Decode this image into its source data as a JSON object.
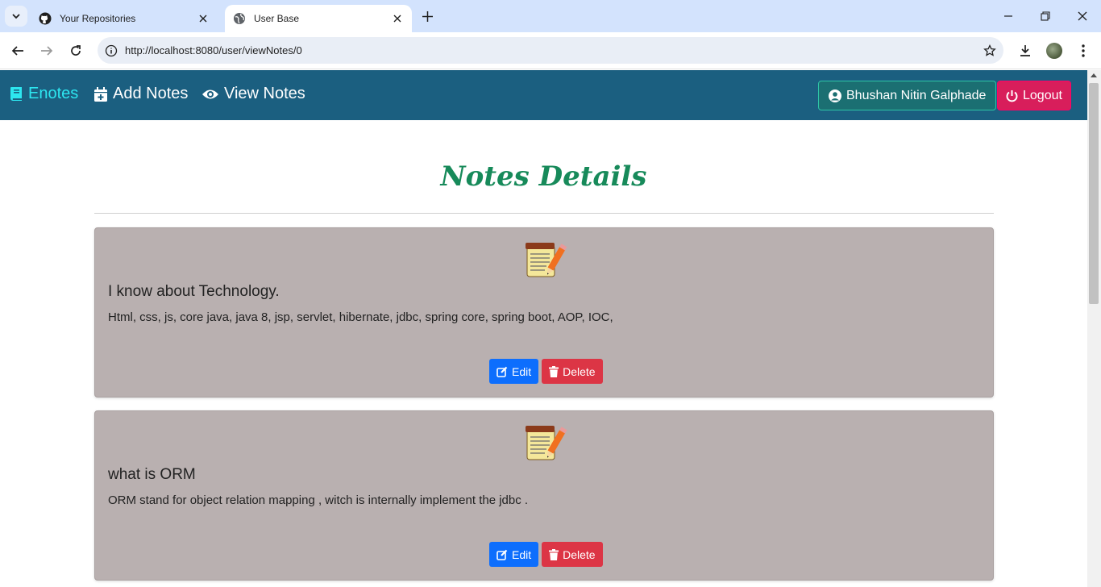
{
  "browser": {
    "tabs": [
      {
        "title": "Your Repositories",
        "icon": "github-icon",
        "active": false
      },
      {
        "title": "User Base",
        "icon": "globe-icon",
        "active": true
      }
    ],
    "url": "http://localhost:8080/user/viewNotes/0"
  },
  "navbar": {
    "brand": "Enotes",
    "links": [
      {
        "label": "Add Notes",
        "icon": "calendar-plus-icon"
      },
      {
        "label": "View Notes",
        "icon": "eye-icon"
      }
    ],
    "user_label": "Bhushan Nitin Galphade",
    "logout_label": "Logout",
    "colors": {
      "bg": "#1b5f80",
      "brand": "#2de6f0",
      "logout": "#d81e5b"
    }
  },
  "page": {
    "title": "Notes Details"
  },
  "notes": [
    {
      "title": "I know about Technology.",
      "body": "Html, css, js, core java, java 8, jsp, servlet, hibernate, jdbc, spring core, spring boot, AOP, IOC,",
      "edit_label": "Edit",
      "delete_label": "Delete"
    },
    {
      "title": "what is ORM",
      "body": "ORM stand for object relation mapping , witch is internally implement the jdbc .",
      "edit_label": "Edit",
      "delete_label": "Delete"
    }
  ]
}
